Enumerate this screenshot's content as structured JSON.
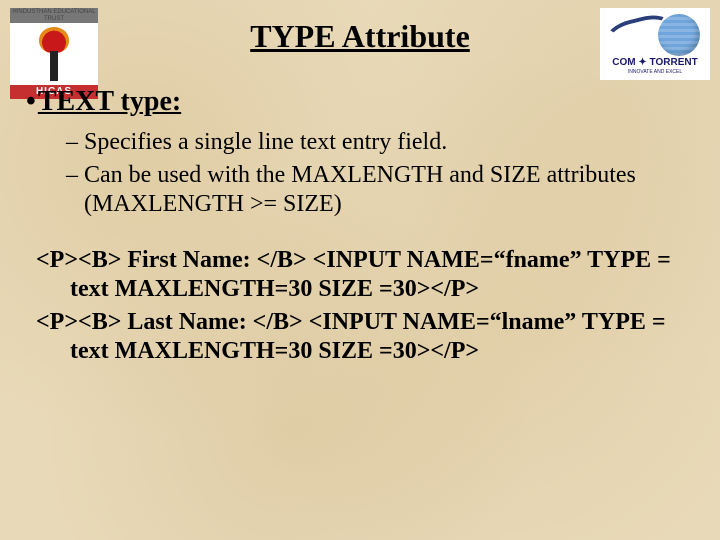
{
  "logos": {
    "left_top": "HINDUSTHAN EDUCATIONAL TRUST",
    "left_label": "HICAS",
    "right_brand": "COM ✦ TORRENT",
    "right_tag": "INNOVATE AND EXCEL"
  },
  "title": "TYPE Attribute",
  "heading": "TEXT type:",
  "bullets": [
    "Specifies a single line text entry field.",
    "Can be used with the MAXLENGTH and SIZE attributes (MAXLENGTH >= SIZE)"
  ],
  "code_lines": [
    "<P><B> First Name: </B> <INPUT NAME=“fname” TYPE = text MAXLENGTH=30 SIZE =30></P>",
    "<P><B> Last Name: </B> <INPUT NAME=“lname” TYPE = text MAXLENGTH=30 SIZE =30></P>"
  ]
}
